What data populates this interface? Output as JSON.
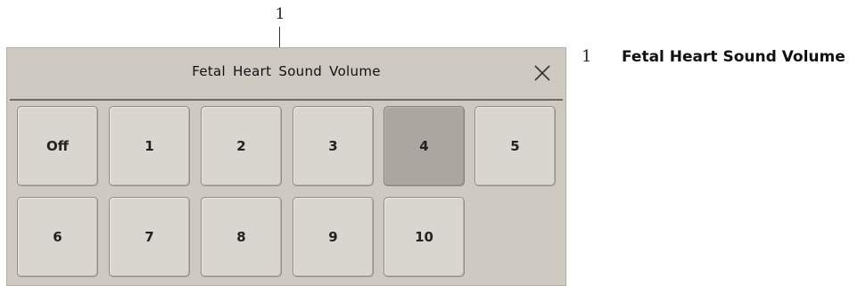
{
  "callout": {
    "number": "1"
  },
  "dialog": {
    "title": "Fetal Heart Sound Volume",
    "close_icon": "close-icon",
    "selected": "4",
    "options_row1": [
      "Off",
      "1",
      "2",
      "3",
      "4",
      "5"
    ],
    "options_row2": [
      "6",
      "7",
      "8",
      "9",
      "10"
    ]
  },
  "legend": {
    "number": "1",
    "text": "Fetal Heart Sound Volume"
  },
  "colors": {
    "dialog_bg": "#cec9c1",
    "key_bg": "#d9d5cf",
    "key_selected_bg": "#aba69f"
  }
}
